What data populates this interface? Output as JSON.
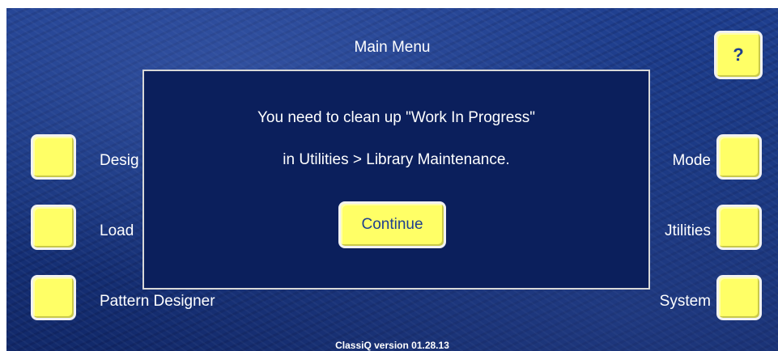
{
  "screen": {
    "title": "Main Menu",
    "help_label": "?",
    "version": "ClassiQ version 01.28.13"
  },
  "left_menu": [
    {
      "label": "Desig"
    },
    {
      "label": "Load"
    },
    {
      "label": "Pattern Designer"
    }
  ],
  "right_menu": [
    {
      "label": "Mode"
    },
    {
      "label": "Jtilities"
    },
    {
      "label": "System"
    }
  ],
  "dialog": {
    "line1": "You need to clean up \"Work In Progress\"",
    "line2": "in Utilities > Library Maintenance.",
    "continue_label": "Continue"
  },
  "colors": {
    "background": "#183680",
    "dialog_background": "#0b1f5c",
    "button_fill": "#ffff66",
    "button_text": "#1f3f8f"
  },
  "icons": {
    "help": "question-mark-icon"
  }
}
